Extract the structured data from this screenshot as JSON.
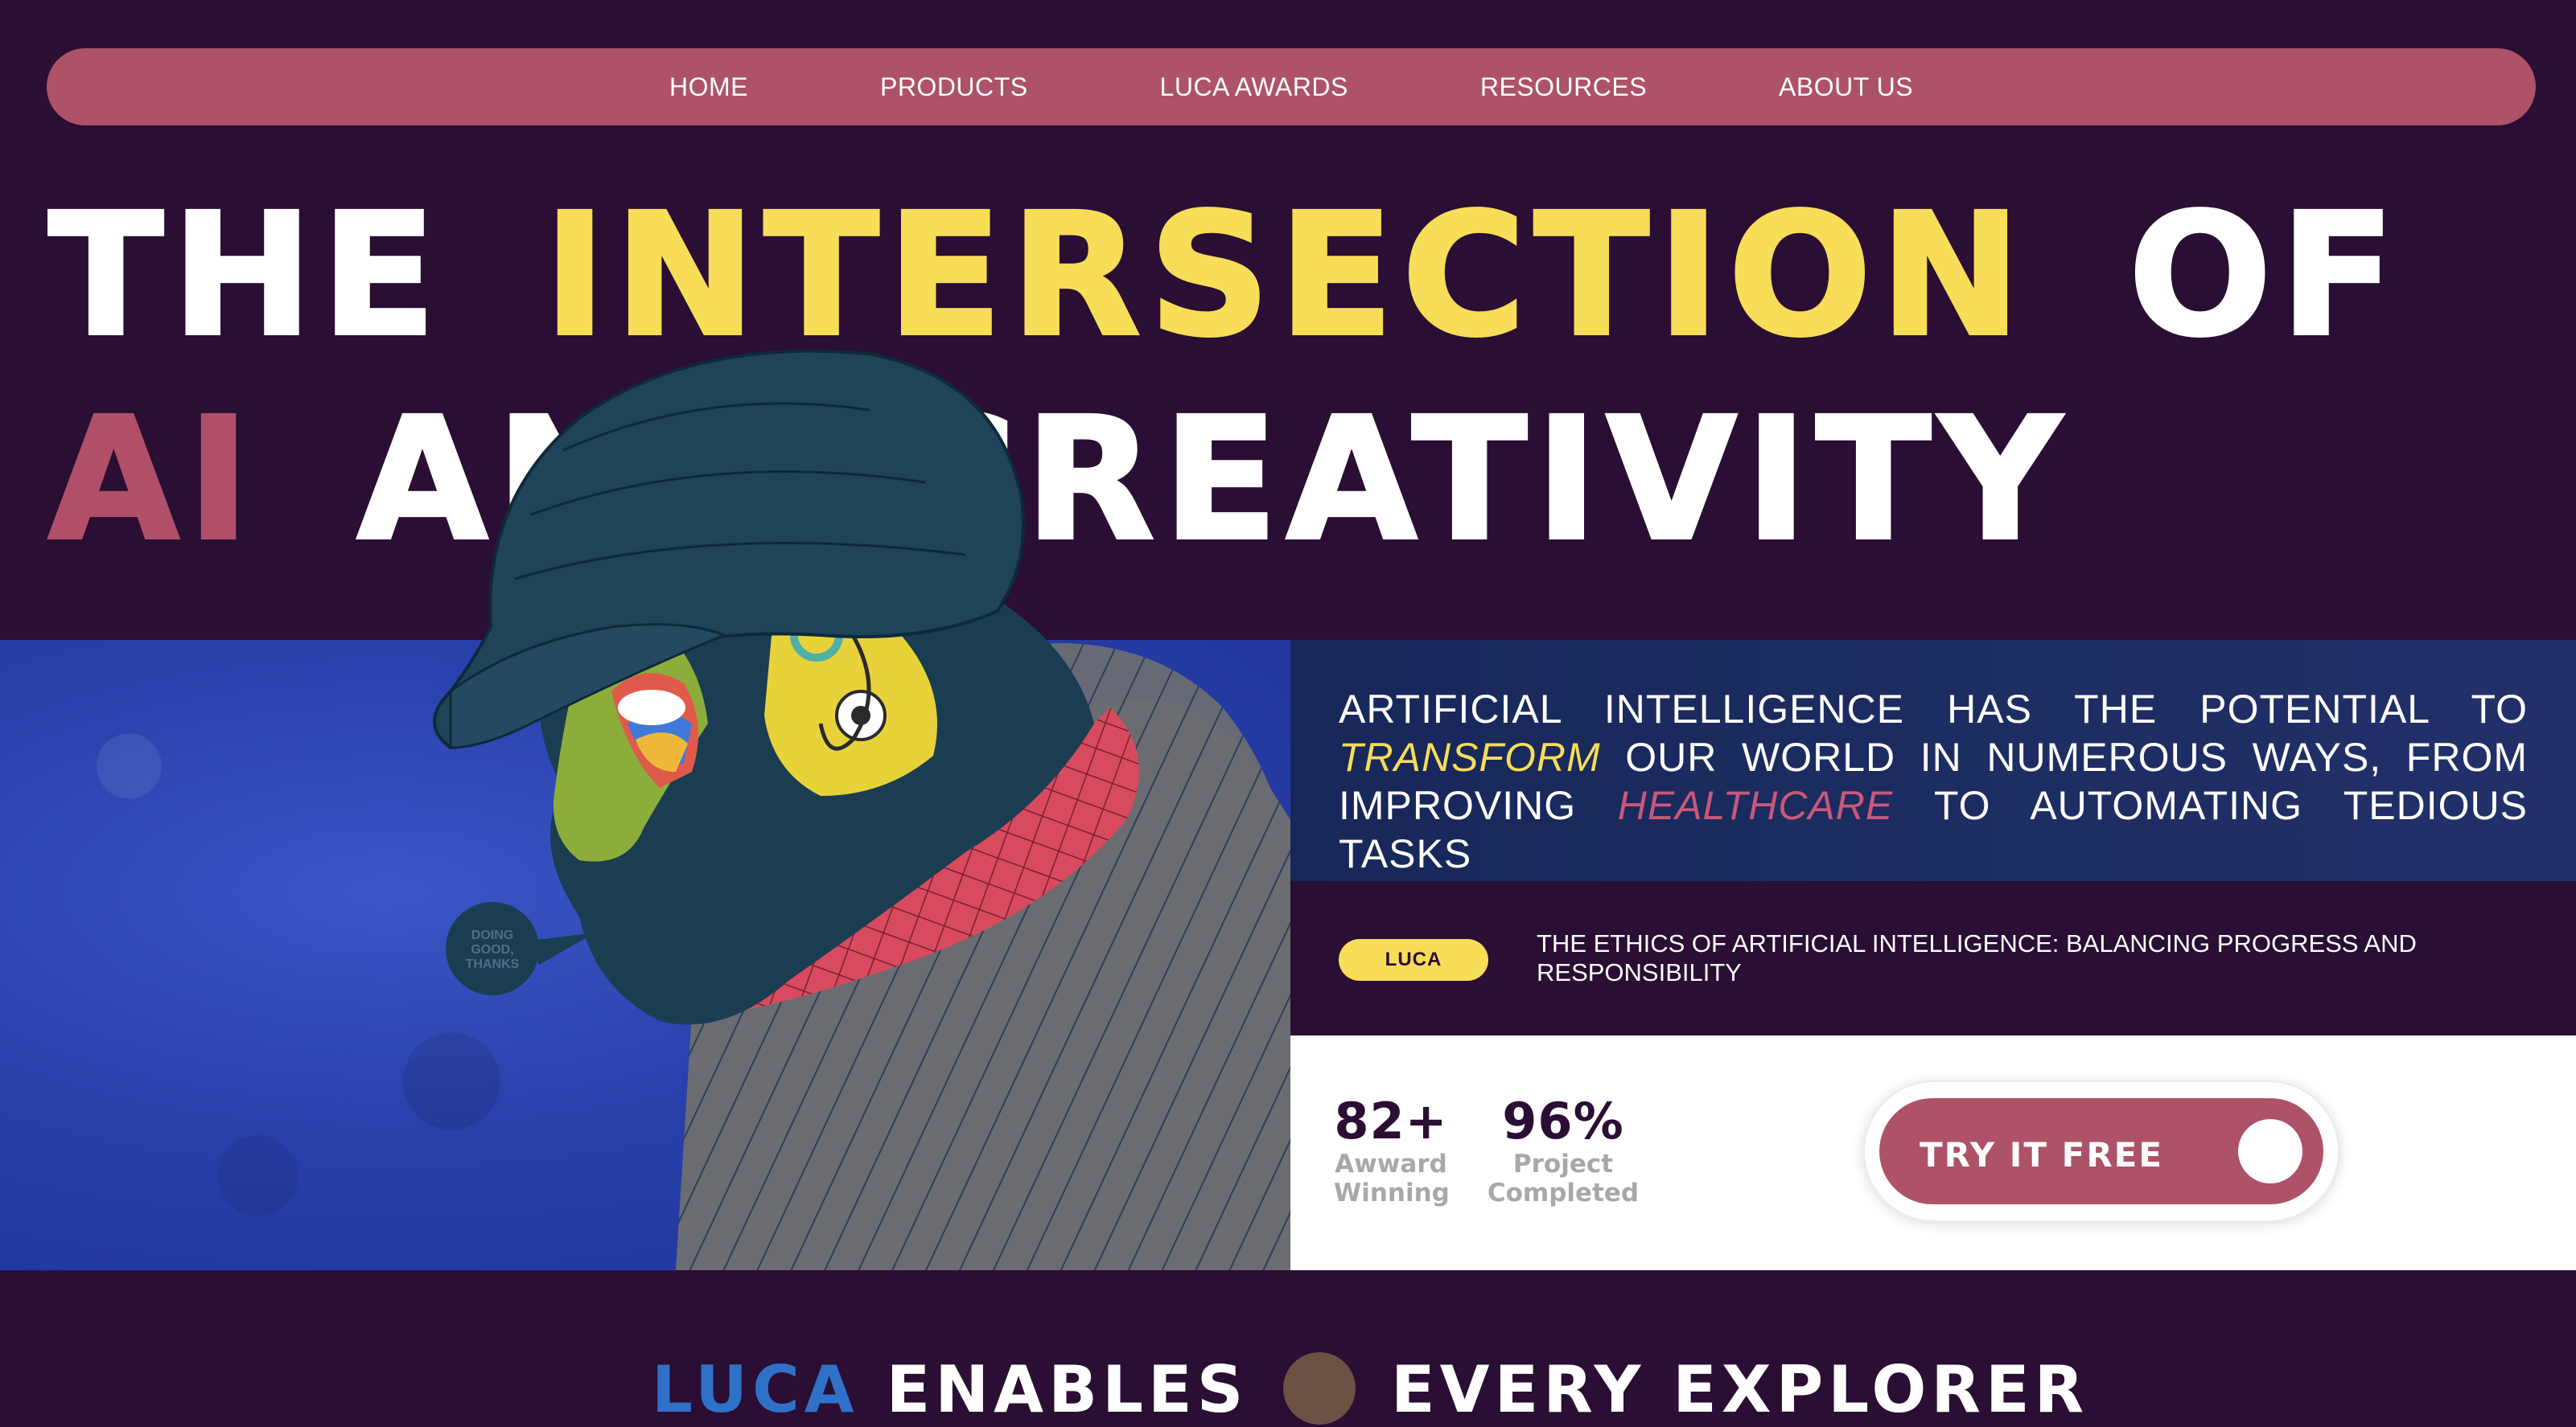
{
  "nav": {
    "items": [
      "HOME",
      "PRODUCTS",
      "LUCA AWARDS",
      "RESOURCES",
      "ABOUT US"
    ]
  },
  "headline": {
    "line1": [
      "THE",
      "INTERSECTION",
      "OF"
    ],
    "line2": [
      "AI",
      "AND",
      "CREATIVITY"
    ]
  },
  "intro": {
    "part1": "ARTIFICIAL INTELLIGENCE HAS THE POTENTIAL TO",
    "highlight1": "TRANSFORM",
    "part2": "OUR WORLD IN NUMEROUS WAYS, FROM IMPROVING",
    "highlight2": "HEALTHCARE",
    "part3": "TO AUTOMATING TEDIOUS TASKS"
  },
  "article": {
    "badge": "LUCA",
    "title": "THE ETHICS OF ARTIFICIAL INTELLIGENCE: BALANCING PROGRESS AND RESPONSIBILITY"
  },
  "stats": [
    {
      "value": "82+",
      "label_line1": "Awward",
      "label_line2": "Winning"
    },
    {
      "value": "96%",
      "label_line1": "Project",
      "label_line2": "Completed"
    }
  ],
  "cta": {
    "label": "TRY IT FREE"
  },
  "illustration": {
    "speech_bubble": "DOING GOOD, THANKS"
  },
  "teaser": {
    "word1": "LUCA",
    "word2": "ENABLES",
    "word3": "EVERY EXPLORER"
  },
  "colors": {
    "background": "#2a0e33",
    "nav": "#ad5267",
    "yellow": "#f7dd58",
    "pink": "#b14f68",
    "blue_panel": "#2840aa"
  }
}
